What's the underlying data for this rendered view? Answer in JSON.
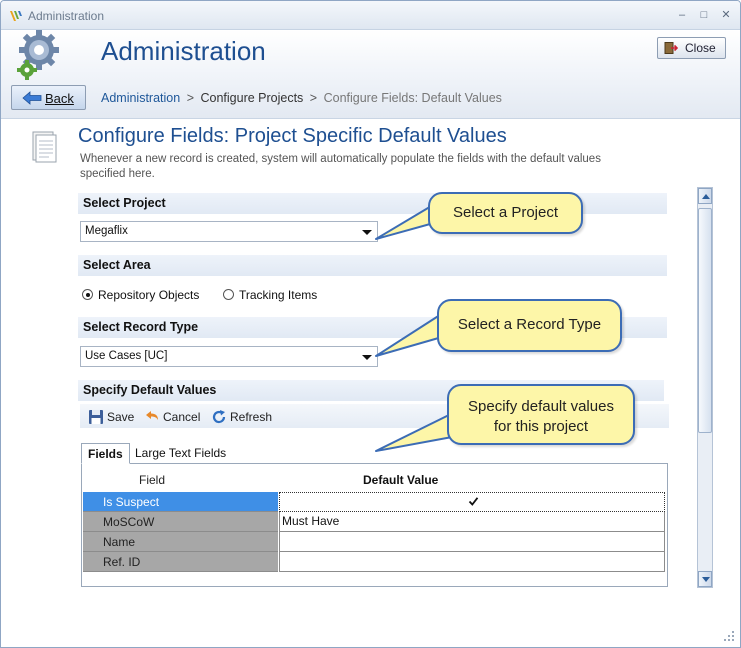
{
  "window": {
    "title": "Administration",
    "minimize": "–",
    "maximize": "□",
    "close": "✕"
  },
  "header": {
    "title": "Administration",
    "close_label": "Close",
    "back_label": "Back",
    "breadcrumb": {
      "root": "Administration",
      "sep1": ">",
      "mid": "Configure Projects",
      "sep2": ">",
      "current": "Configure Fields: Default Values"
    }
  },
  "page": {
    "title": "Configure Fields: Project Specific Default Values",
    "description": "Whenever a new record is created, system will automatically populate the fields with the default values specified here."
  },
  "sections": {
    "project": {
      "label": "Select Project",
      "value": "Megaflix"
    },
    "area": {
      "label": "Select Area",
      "options": [
        "Repository Objects",
        "Tracking Items"
      ],
      "selected": "Repository Objects"
    },
    "record_type": {
      "label": "Select Record Type",
      "value": "Use Cases [UC]"
    },
    "defaults": {
      "label": "Specify Default Values"
    }
  },
  "toolbar": {
    "save": "Save",
    "cancel": "Cancel",
    "refresh": "Refresh"
  },
  "tabs": [
    "Fields",
    "Large Text Fields"
  ],
  "active_tab": "Fields",
  "grid": {
    "columns": [
      "Field",
      "Default Value"
    ],
    "rows": [
      {
        "field": "Is Suspect",
        "value": "",
        "checked": true,
        "selected": true
      },
      {
        "field": "MoSCoW",
        "value": "Must Have"
      },
      {
        "field": "Name",
        "value": ""
      },
      {
        "field": "Ref. ID",
        "value": ""
      }
    ]
  },
  "callouts": {
    "project": "Select a Project",
    "record_type": "Select a Record Type",
    "defaults_line1": "Specify default values",
    "defaults_line2": "for this project"
  },
  "colors": {
    "accent_title": "#1e4f91",
    "callout_fill": "#fdf6a8",
    "callout_border": "#3c6cb5",
    "selected_row": "#3f8fe6"
  }
}
